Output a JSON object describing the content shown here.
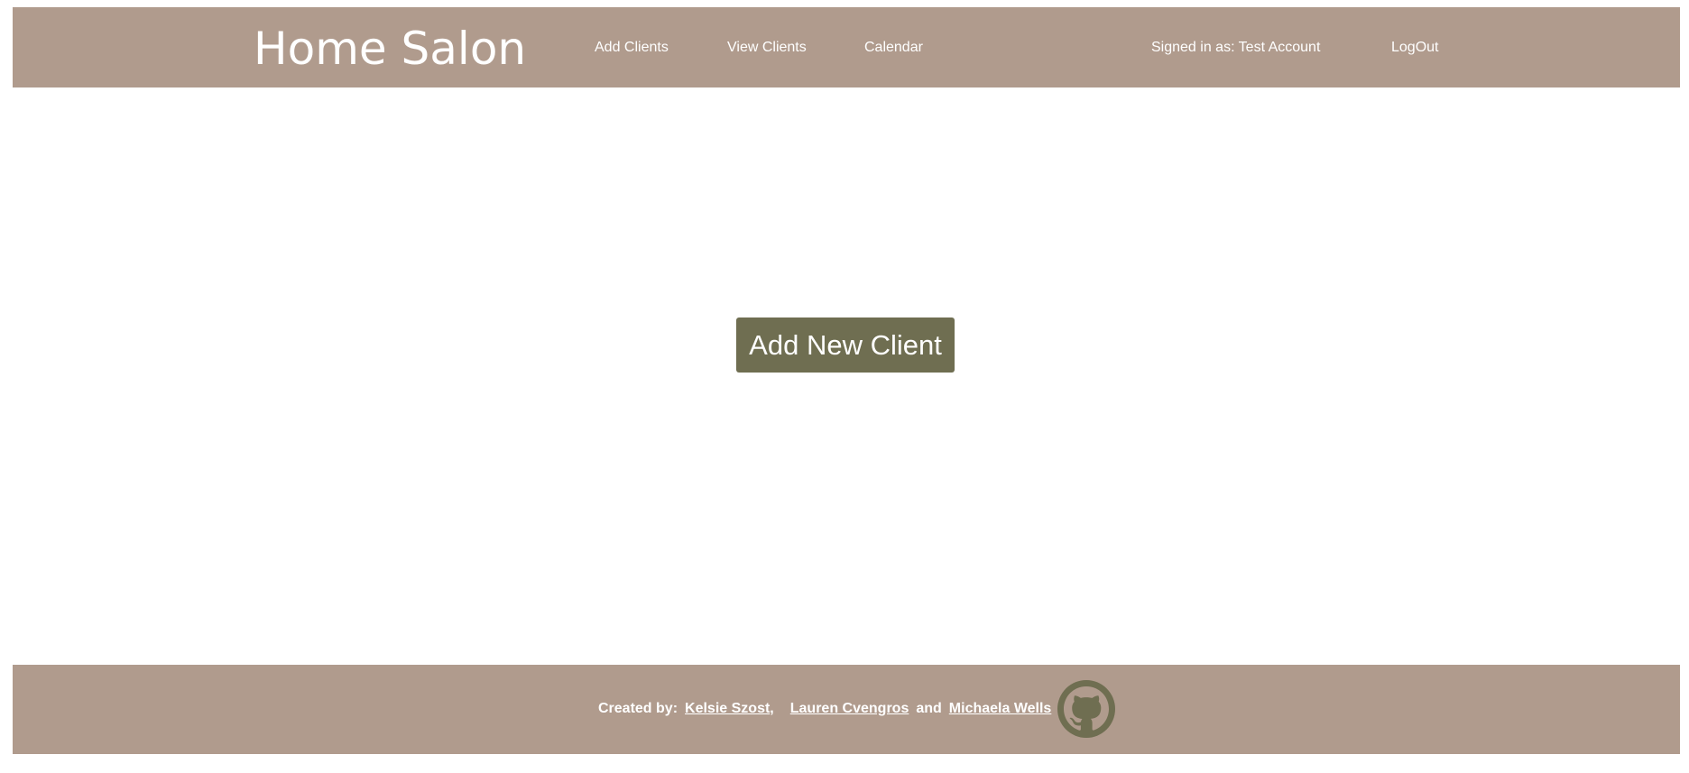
{
  "header": {
    "brand": "Home Salon",
    "nav": {
      "add_clients": "Add Clients",
      "view_clients": "View Clients",
      "calendar": "Calendar"
    },
    "signed_in": "Signed in as: Test Account",
    "logout": "LogOut"
  },
  "main": {
    "add_button_label": "Add New Client"
  },
  "footer": {
    "created_by": "Created by:",
    "authors": [
      {
        "name": "Kelsie Szost"
      },
      {
        "name": "Lauren Cvengros"
      },
      {
        "name": "Michaela Wells"
      }
    ],
    "comma": ",",
    "and": "and",
    "icon": "github-icon"
  },
  "colors": {
    "bar_background": "#b09b8d",
    "button_background": "#6f6e51",
    "text_light": "#ffffff"
  }
}
